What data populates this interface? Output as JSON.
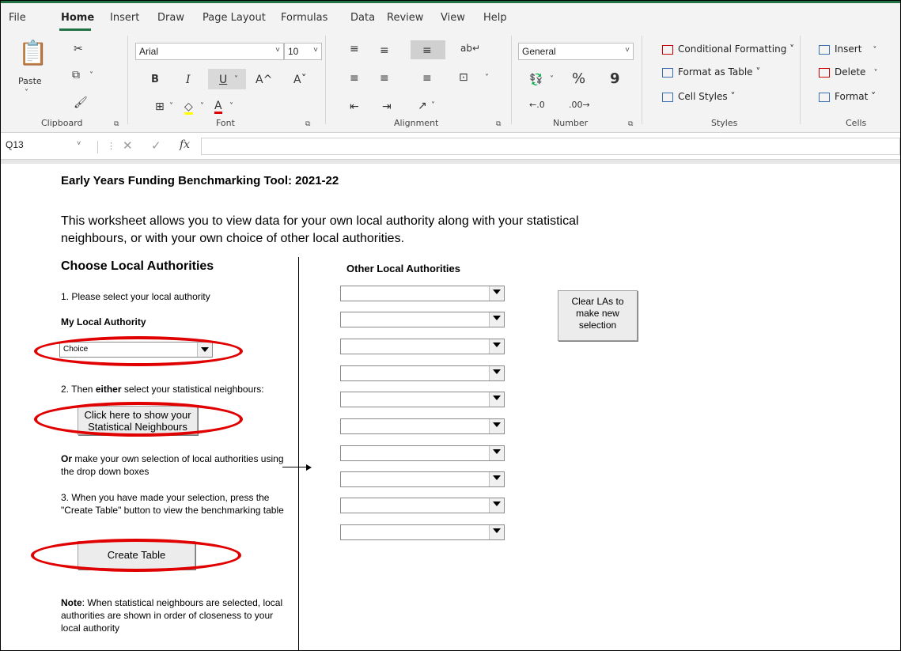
{
  "menu": {
    "tabs": [
      "File",
      "Home",
      "Insert",
      "Draw",
      "Page Layout",
      "Formulas",
      "Data",
      "Review",
      "View",
      "Help"
    ],
    "active": "Home"
  },
  "ribbon": {
    "clipboard": {
      "paste": "Paste",
      "label": "Clipboard"
    },
    "font": {
      "name": "Arial",
      "size": "10",
      "bold": "B",
      "italic": "I",
      "underline": "U",
      "grow": "A^",
      "shrink": "Aˇ",
      "color_a": "A",
      "label": "Font"
    },
    "alignment": {
      "label": "Alignment"
    },
    "number": {
      "format": "General",
      "percent": "%",
      "comma": "9",
      "label": "Number"
    },
    "styles": {
      "conditional": "Conditional Formatting ˅",
      "format_table": "Format as Table ˅",
      "cell_styles": "Cell Styles ˅",
      "label": "Styles"
    },
    "cells": {
      "insert": "Insert",
      "delete": "Delete",
      "format": "Format ˅",
      "label": "Cells"
    }
  },
  "formula_bar": {
    "name_box": "Q13",
    "fx": "fx",
    "value": ""
  },
  "sheet": {
    "title": "Early Years Funding Benchmarking Tool: 2021-22",
    "intro": "This worksheet allows you to view data for your own local authority along with your statistical neighbours, or with your own choice of other local authorities.",
    "choose_heading": "Choose Local Authorities",
    "other_heading": "Other Local Authorities",
    "step1": "1. Please select your local authority",
    "my_la_label": "My Local Authority",
    "my_la_value": "Choice",
    "step2_prefix": "2. Then ",
    "step2_bold": "either",
    "step2_suffix": " select your statistical neighbours:",
    "stat_button": "Click here to show your Statistical Neighbours",
    "or_bold": "Or",
    "or_text": " make your own selection of local authorities using the drop down boxes",
    "step3": "3. When you have made your selection, press the \"Create Table\" button to view the benchmarking table",
    "create_button": "Create Table",
    "clear_button": "Clear LAs to make new selection",
    "note_bold": "Note",
    "note_text": ": When statistical neighbours are selected, local authorities are shown in order of closeness to your local authority",
    "other_la_values": [
      "",
      "",
      "",
      "",
      "",
      "",
      "",
      "",
      "",
      ""
    ]
  },
  "colors": {
    "excel_green": "#217346",
    "highlight_red": "#e00000"
  }
}
